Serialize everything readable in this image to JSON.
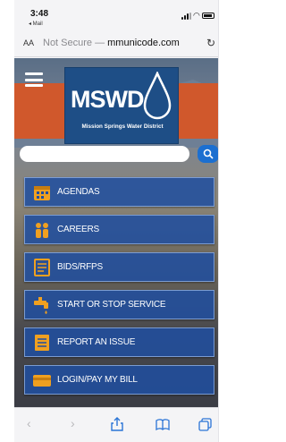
{
  "status_bar": {
    "time": "3:48",
    "back_app": "◂ Mail"
  },
  "url_bar": {
    "aa": "AA",
    "prefix": "Not Secure — ",
    "host": "mmunicode.com"
  },
  "site": {
    "logo_text": "MSWD",
    "logo_subtitle": "Mission Springs Water District",
    "search_placeholder": ""
  },
  "menu": [
    {
      "label": "AGENDAS",
      "icon": "calendar-icon"
    },
    {
      "label": "CAREERS",
      "icon": "people-icon"
    },
    {
      "label": "BIDS/RFPS",
      "icon": "document-icon"
    },
    {
      "label": "START OR STOP SERVICE",
      "icon": "faucet-icon"
    },
    {
      "label": "REPORT AN ISSUE",
      "icon": "report-icon"
    },
    {
      "label": "LOGIN/PAY MY BILL",
      "icon": "credit-card-icon"
    }
  ],
  "colors": {
    "accent": "#1c6fd0",
    "band": "#d0582c",
    "menu_bg": "#204ea0",
    "icon": "#f0a020"
  }
}
